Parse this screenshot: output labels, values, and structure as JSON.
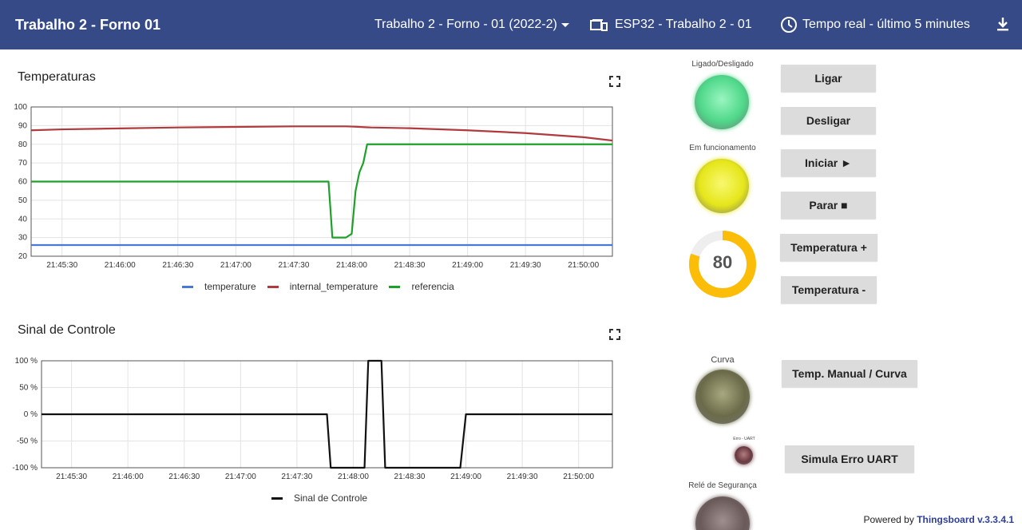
{
  "header": {
    "title": "Trabalho 2 - Forno 01",
    "dashboard_state": "Trabalho 2 - Forno - 01 (2022-2)",
    "device": "ESP32 - Trabalho 2 - 01",
    "time_window": "Tempo real - último 5 minutes"
  },
  "widgets": {
    "temperaturas_title": "Temperaturas",
    "controle_title": "Sinal de Controle"
  },
  "controls": {
    "led_on_label": "Ligado/Desligado",
    "led_running_label": "Em funcionamento",
    "led_curve_label": "Curva",
    "led_uart_label": "Erro - UART",
    "led_relay_label": "Relé de Segurança",
    "btn_ligar": "Ligar",
    "btn_desligar": "Desligar",
    "btn_iniciar": "Iniciar ►",
    "btn_parar": "Parar ■",
    "btn_temp_plus": "Temperatura +",
    "btn_temp_minus": "Temperatura -",
    "btn_curva": "Temp. Manual / Curva",
    "btn_uart": "Simula Erro UART",
    "gauge_value": "80",
    "gauge_fraction": 0.8,
    "colors": {
      "led_on": "#4fd88a",
      "led_running": "#e6e61a",
      "led_curve": "#6b6b4a",
      "led_uart": "#6b3a40",
      "led_relay": "#6b5a5a",
      "gauge": "#fbbd08"
    }
  },
  "footer": {
    "powered_by": "Powered by",
    "brand": "Thingsboard v.3.3.4.1"
  },
  "chart_data": [
    {
      "type": "line",
      "title": "Temperaturas",
      "x": [
        "21:45:14",
        "21:45:30",
        "21:46:00",
        "21:46:30",
        "21:47:00",
        "21:47:30",
        "21:47:48",
        "21:47:50",
        "21:47:57",
        "21:48:00",
        "21:48:02",
        "21:48:04",
        "21:48:06",
        "21:48:08",
        "21:48:10",
        "21:48:30",
        "21:49:00",
        "21:49:30",
        "21:50:00",
        "21:50:15"
      ],
      "xticks": [
        "21:45:30",
        "21:46:00",
        "21:46:30",
        "21:47:00",
        "21:47:30",
        "21:48:00",
        "21:48:30",
        "21:49:00",
        "21:49:30",
        "21:50:00"
      ],
      "ylim": [
        20,
        100
      ],
      "yticks": [
        20,
        30,
        40,
        50,
        60,
        70,
        80,
        90,
        100
      ],
      "series": [
        {
          "name": "temperature",
          "color": "#4a78d6",
          "values": [
            26,
            26,
            26,
            26,
            26,
            26,
            26,
            26,
            26,
            26,
            26,
            26,
            26,
            26,
            26,
            26,
            26,
            26,
            26,
            26
          ]
        },
        {
          "name": "internal_temperature",
          "color": "#b03a3e",
          "values": [
            87.5,
            88,
            88.5,
            89,
            89.3,
            89.6,
            89.6,
            89.6,
            89.6,
            89.5,
            89.4,
            89.3,
            89.2,
            89.1,
            89,
            88.6,
            87.5,
            86,
            83.8,
            82
          ]
        },
        {
          "name": "referencia",
          "color": "#1ea02a",
          "values": [
            60,
            60,
            60,
            60,
            60,
            60,
            60,
            30,
            30,
            32,
            55,
            65,
            70,
            80,
            80,
            80,
            80,
            80,
            80,
            80
          ]
        }
      ],
      "legend": "bottom"
    },
    {
      "type": "line",
      "title": "Sinal de Controle",
      "x": [
        "21:45:14",
        "21:47:46",
        "21:47:48",
        "21:48:06",
        "21:48:08",
        "21:48:15",
        "21:48:17",
        "21:48:57",
        "21:49:00",
        "21:50:18"
      ],
      "xticks": [
        "21:45:30",
        "21:46:00",
        "21:46:30",
        "21:47:00",
        "21:47:30",
        "21:48:00",
        "21:48:30",
        "21:49:00",
        "21:49:30",
        "21:50:00"
      ],
      "ylim": [
        -100,
        100
      ],
      "yticks": [
        "-100 %",
        "-50 %",
        "0 %",
        "50 %",
        "100 %"
      ],
      "series": [
        {
          "name": "Sinal de Controle",
          "color": "#111111",
          "values": [
            0,
            0,
            -100,
            -100,
            100,
            100,
            -100,
            -100,
            0,
            0
          ]
        }
      ],
      "legend": "bottom"
    }
  ]
}
